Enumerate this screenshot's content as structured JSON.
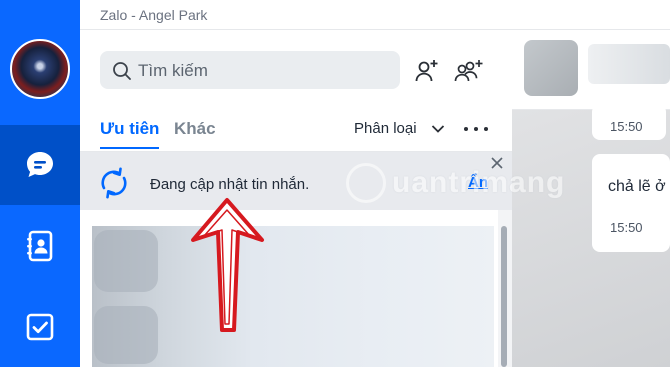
{
  "window": {
    "title": "Zalo - Angel Park"
  },
  "colors": {
    "accent": "#0068ff",
    "nav_bg": "#0a68ff",
    "nav_active": "#0050c8",
    "annotation": "#d6191f"
  },
  "nav": {
    "items": [
      "messages-icon",
      "contacts-icon",
      "todo-icon"
    ]
  },
  "search": {
    "placeholder": "Tìm kiếm"
  },
  "tabs": {
    "priority": "Ưu tiên",
    "other": "Khác"
  },
  "filter": {
    "label": "Phân loại"
  },
  "banner": {
    "text": "Đang cập nhật tin nhắn.",
    "hide_label": "Ẩn"
  },
  "chat": {
    "messages": [
      {
        "time": "15:50"
      },
      {
        "text": "chả lẽ ở",
        "time": "15:50"
      }
    ]
  },
  "watermark": {
    "text": "uantrimang"
  }
}
